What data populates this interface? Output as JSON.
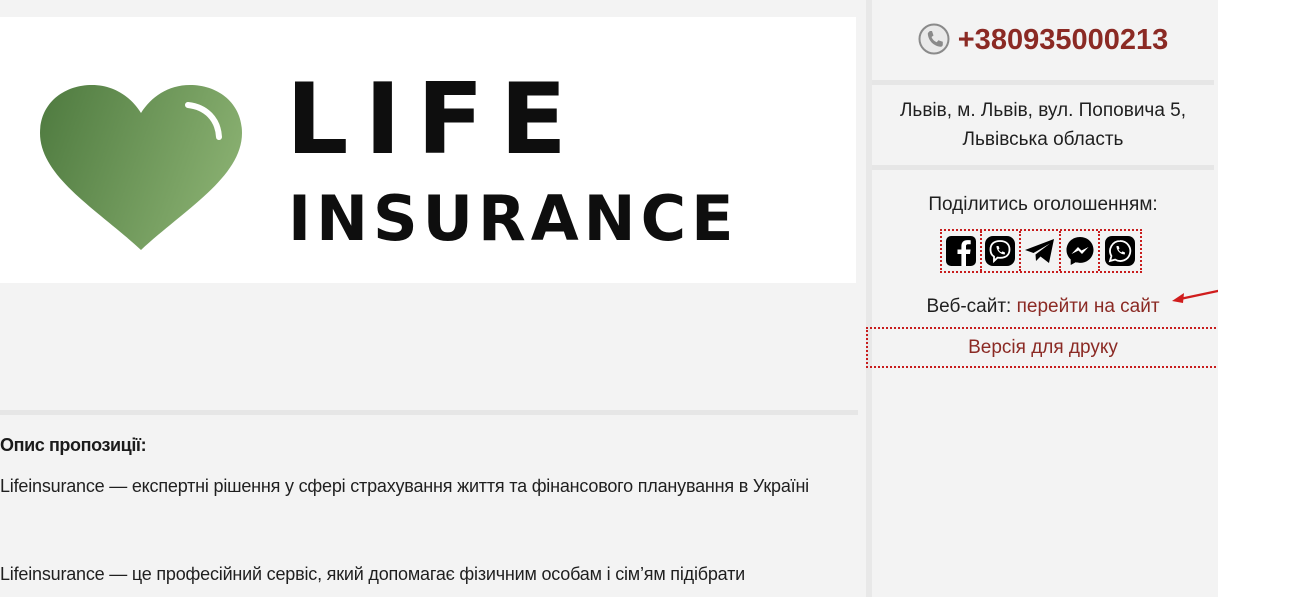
{
  "logo": {
    "line1": "LIFE",
    "line2": "INSURANCE",
    "heart_color_dark": "#4e7a3f",
    "heart_color_light": "#86ad6e"
  },
  "description": {
    "heading": "Опис пропозиції:",
    "paragraphs": [
      "Lifeinsurance — експертні рішення у сфері страхування життя та фінансового планування в Україні",
      "Lifeinsurance — це професійний сервіс, який допомагає фізичним особам і сім’ям підібрати"
    ]
  },
  "sidebar": {
    "phone": "+380935000213",
    "phone_icon": "phone-icon",
    "address": "Львів, м. Львів, вул. Поповича 5, Львівська область",
    "share_label": "Поділитись оголошенням:",
    "share_icons": [
      "facebook-icon",
      "viber-icon",
      "telegram-icon",
      "messenger-icon",
      "whatsapp-icon"
    ],
    "website_label": "Веб-сайт:",
    "website_link": "перейти на сайт",
    "print_label": "Версія для друку"
  },
  "colors": {
    "accent": "#8b2a24",
    "dotted_border": "#c81d1d",
    "annotation_arrow": "#d01c1c"
  }
}
